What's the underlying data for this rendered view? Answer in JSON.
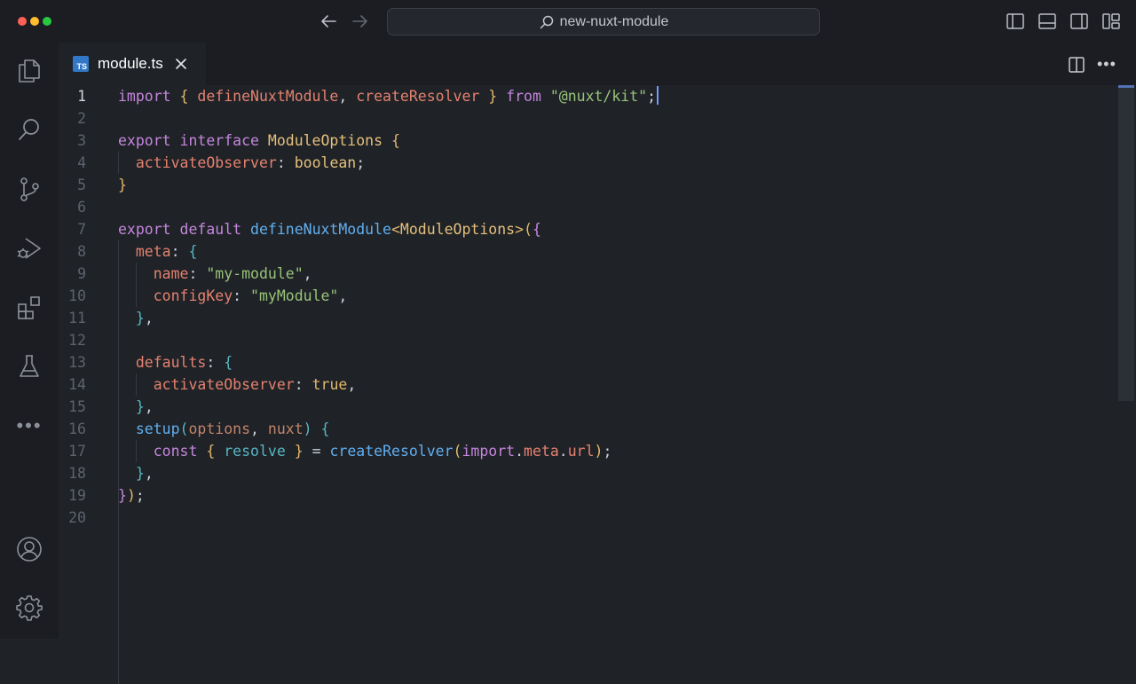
{
  "window": {
    "title": "new-nuxt-module"
  },
  "tab": {
    "label": "module.ts",
    "badge": "TS"
  },
  "editor": {
    "active_line": 1,
    "line_numbers": [
      "1",
      "2",
      "3",
      "4",
      "5",
      "6",
      "7",
      "8",
      "9",
      "10",
      "11",
      "12",
      "13",
      "14",
      "15",
      "16",
      "17",
      "18",
      "19",
      "20"
    ],
    "lines": [
      [
        [
          "kw",
          "import"
        ],
        [
          "plain",
          " "
        ],
        [
          "br1",
          "{"
        ],
        [
          "plain",
          " "
        ],
        [
          "idr",
          "defineNuxtModule"
        ],
        [
          "pun",
          ", "
        ],
        [
          "idr",
          "createResolver"
        ],
        [
          "plain",
          " "
        ],
        [
          "br1",
          "}"
        ],
        [
          "plain",
          " "
        ],
        [
          "kw",
          "from"
        ],
        [
          "plain",
          " "
        ],
        [
          "str",
          "\"@nuxt/kit\""
        ],
        [
          "pun",
          ";"
        ]
      ],
      [],
      [
        [
          "kw",
          "export"
        ],
        [
          "plain",
          " "
        ],
        [
          "kw",
          "interface"
        ],
        [
          "plain",
          " "
        ],
        [
          "typ",
          "ModuleOptions"
        ],
        [
          "plain",
          " "
        ],
        [
          "br1",
          "{"
        ]
      ],
      [
        [
          "plain",
          "  "
        ],
        [
          "idr",
          "activateObserver"
        ],
        [
          "pun",
          ": "
        ],
        [
          "typ",
          "boolean"
        ],
        [
          "pun",
          ";"
        ]
      ],
      [
        [
          "br1",
          "}"
        ]
      ],
      [],
      [
        [
          "kw",
          "export"
        ],
        [
          "plain",
          " "
        ],
        [
          "kw",
          "default"
        ],
        [
          "plain",
          " "
        ],
        [
          "fn",
          "defineNuxtModule"
        ],
        [
          "br1",
          "<"
        ],
        [
          "typ",
          "ModuleOptions"
        ],
        [
          "br1",
          ">"
        ],
        [
          "br1",
          "("
        ],
        [
          "br2",
          "{"
        ]
      ],
      [
        [
          "plain",
          "  "
        ],
        [
          "idr",
          "meta"
        ],
        [
          "pun",
          ": "
        ],
        [
          "br3",
          "{"
        ]
      ],
      [
        [
          "plain",
          "    "
        ],
        [
          "idr",
          "name"
        ],
        [
          "pun",
          ": "
        ],
        [
          "str",
          "\"my-module\""
        ],
        [
          "pun",
          ","
        ]
      ],
      [
        [
          "plain",
          "    "
        ],
        [
          "idr",
          "configKey"
        ],
        [
          "pun",
          ": "
        ],
        [
          "str",
          "\"myModule\""
        ],
        [
          "pun",
          ","
        ]
      ],
      [
        [
          "plain",
          "  "
        ],
        [
          "br3",
          "}"
        ],
        [
          "pun",
          ","
        ]
      ],
      [],
      [
        [
          "plain",
          "  "
        ],
        [
          "idr",
          "defaults"
        ],
        [
          "pun",
          ": "
        ],
        [
          "br3",
          "{"
        ]
      ],
      [
        [
          "plain",
          "    "
        ],
        [
          "idr",
          "activateObserver"
        ],
        [
          "pun",
          ": "
        ],
        [
          "br1",
          "true"
        ],
        [
          "pun",
          ","
        ]
      ],
      [
        [
          "plain",
          "  "
        ],
        [
          "br3",
          "}"
        ],
        [
          "pun",
          ","
        ]
      ],
      [
        [
          "plain",
          "  "
        ],
        [
          "fn",
          "setup"
        ],
        [
          "br3",
          "("
        ],
        [
          "prm",
          "options"
        ],
        [
          "pun",
          ", "
        ],
        [
          "prm",
          "nuxt"
        ],
        [
          "br3",
          ")"
        ],
        [
          "plain",
          " "
        ],
        [
          "br3",
          "{"
        ]
      ],
      [
        [
          "plain",
          "    "
        ],
        [
          "kw",
          "const"
        ],
        [
          "plain",
          " "
        ],
        [
          "br1",
          "{"
        ],
        [
          "plain",
          " "
        ],
        [
          "var",
          "resolve"
        ],
        [
          "plain",
          " "
        ],
        [
          "br1",
          "}"
        ],
        [
          "plain",
          " "
        ],
        [
          "pun",
          "= "
        ],
        [
          "fn",
          "createResolver"
        ],
        [
          "br1",
          "("
        ],
        [
          "kw",
          "import"
        ],
        [
          "pun",
          "."
        ],
        [
          "idr",
          "meta"
        ],
        [
          "pun",
          "."
        ],
        [
          "idr",
          "url"
        ],
        [
          "br1",
          ")"
        ],
        [
          "pun",
          ";"
        ]
      ],
      [
        [
          "plain",
          "  "
        ],
        [
          "br3",
          "}"
        ],
        [
          "pun",
          ","
        ]
      ],
      [
        [
          "br2",
          "}"
        ],
        [
          "br1",
          ")"
        ],
        [
          "pun",
          ";"
        ]
      ],
      []
    ]
  },
  "icons": {
    "activity": [
      "explorer-icon",
      "search-icon",
      "source-control-icon",
      "run-debug-icon",
      "extensions-icon",
      "testing-icon",
      "more-icon",
      "accounts-icon",
      "manage-gear-icon"
    ],
    "titlebar": [
      "back-arrow-icon",
      "forward-arrow-icon",
      "toggle-primary-sidebar-icon",
      "toggle-panel-icon",
      "toggle-secondary-sidebar-icon",
      "customize-layout-icon"
    ]
  },
  "colors": {
    "keyword": "#c586dd",
    "string": "#98c379",
    "function": "#61afef",
    "type": "#e5c07b",
    "identifier": "#e4826f",
    "background": "#1f2227",
    "chrome": "#1b1d22",
    "ts_badge": "#3178c6"
  }
}
